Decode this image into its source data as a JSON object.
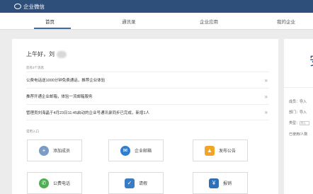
{
  "app": {
    "title": "企业微信"
  },
  "nav": {
    "tabs": [
      {
        "label": "首页"
      },
      {
        "label": "通讯录"
      },
      {
        "label": "企业应用"
      },
      {
        "label": "我的企业"
      }
    ]
  },
  "greeting": {
    "text": "上午好，刘"
  },
  "pending": {
    "title": "您有3个消息",
    "items": [
      {
        "text": "公费电话送1000分钟免费通话，推荐企业体验"
      },
      {
        "text": "推荐开通企业邮箱，体验一流邮箱服务"
      },
      {
        "text": "管理员刘海晶于4月23日11:45启动的企业号通讯录同步已完成，新增1人"
      }
    ],
    "arrow": "»"
  },
  "common": {
    "title": "常用入口",
    "tiles": [
      {
        "label": "添加成员",
        "icon": "add-member-icon",
        "color": "#7a9cc9",
        "glyph": "+"
      },
      {
        "label": "企业邮箱",
        "icon": "mail-icon",
        "color": "#2f7fd1",
        "glyph": "✉"
      },
      {
        "label": "发布公告",
        "icon": "announcement-icon",
        "color": "#f0a526",
        "glyph": "▲"
      },
      {
        "label": "公费电话",
        "icon": "phone-icon",
        "color": "#4caf50",
        "glyph": "✆"
      },
      {
        "label": "请假",
        "icon": "leave-icon",
        "color": "#3a7cc4",
        "glyph": "✓"
      },
      {
        "label": "报销",
        "icon": "reimburse-icon",
        "color": "#2f6fb8",
        "glyph": "¥"
      }
    ]
  },
  "right": {
    "big": "安",
    "rows": [
      {
        "label": "成员：",
        "value": "导入"
      },
      {
        "label": "部门：",
        "value": "导入"
      },
      {
        "label": "类型：",
        "value": "默认"
      },
      {
        "label": "已使用/人数",
        "value": ""
      }
    ]
  }
}
